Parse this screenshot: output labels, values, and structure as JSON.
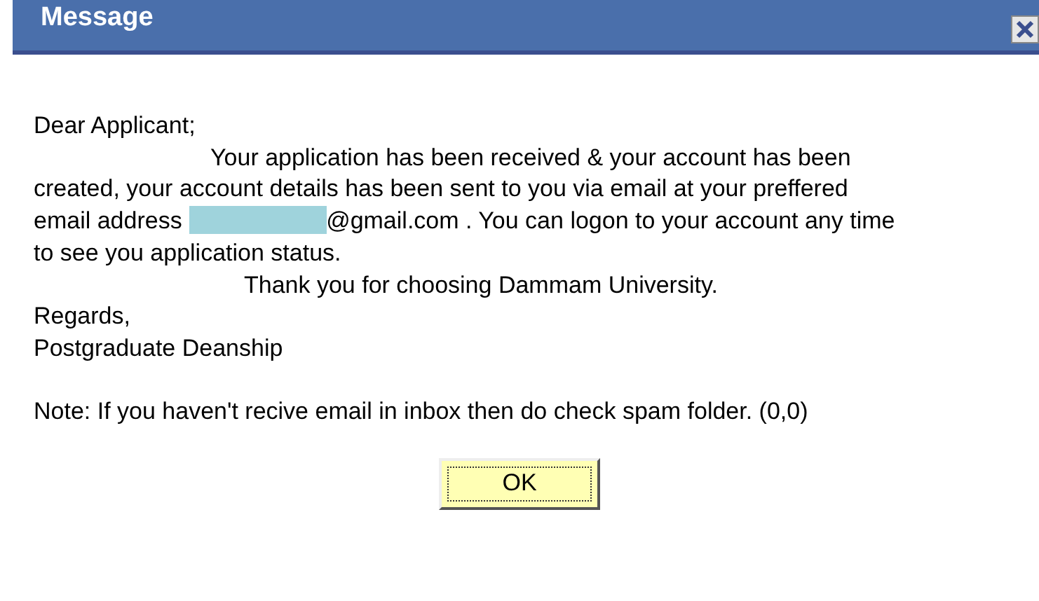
{
  "window": {
    "title": "Message"
  },
  "message": {
    "greeting": "Dear Applicant;",
    "body_lines": [
      {
        "kind": "indented",
        "text": "Your application has been received & your account has been"
      },
      {
        "kind": "plain",
        "text": "created, your account details has been sent to you via email at your preffered"
      },
      {
        "kind": "redacted",
        "before": "email address",
        "after": "@gmail.com . You can logon to your account any time"
      },
      {
        "kind": "plain",
        "text": "to see you application status."
      },
      {
        "kind": "centered",
        "text": "Thank you for choosing Dammam University."
      },
      {
        "kind": "plain",
        "text": "Regards,"
      },
      {
        "kind": "plain",
        "text": "Postgraduate Deanship"
      }
    ],
    "note": "Note: If you haven't recive email in inbox then do check spam folder. (0,0)"
  },
  "buttons": [
    "OK"
  ]
}
